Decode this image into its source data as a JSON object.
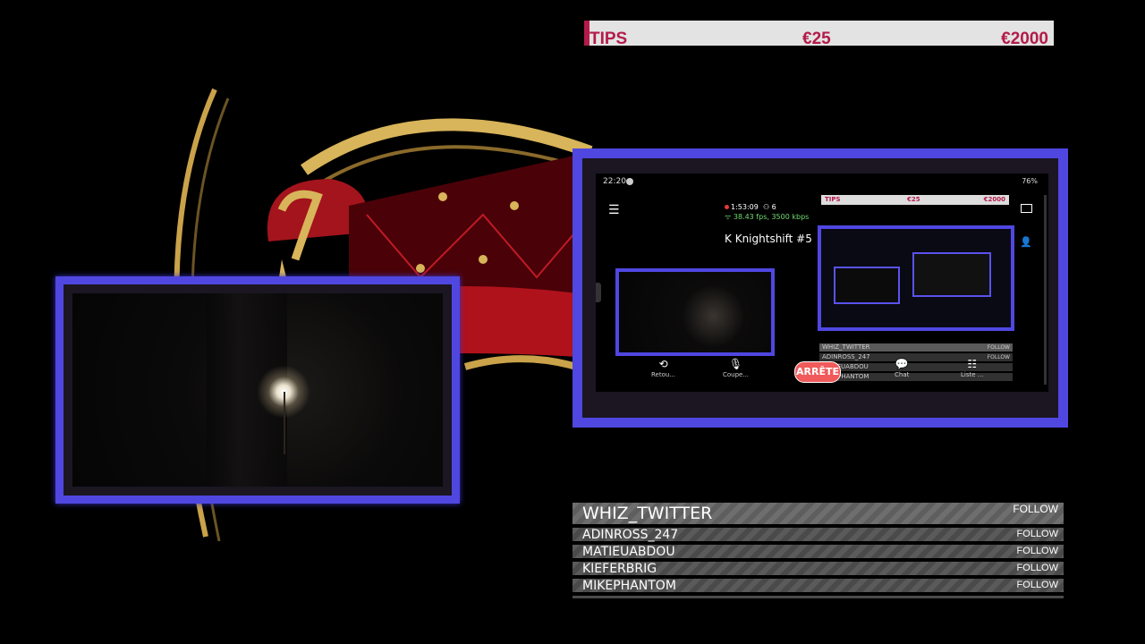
{
  "tips_bar": {
    "label": "TIPS",
    "amount": "€25",
    "goal": "€2000"
  },
  "phone": {
    "time": "22:20",
    "status": "76%",
    "rec_time": "1:53:09",
    "viewers": "6",
    "stream_stats": "38.43 fps, 3500 kbps",
    "stream_title": "Knightshift #5",
    "mini_tips": {
      "label": "TIPS",
      "amount": "€25",
      "goal": "€2000"
    },
    "buttons": {
      "back_label": "Retou...",
      "mute_label": "Coupe...",
      "stop_label": "ARRÊTE",
      "chat_label": "Chat",
      "list_label": "Liste ..."
    },
    "mini_feed": [
      {
        "name": "WHIZ_TWITTER",
        "badge": "FOLLOW"
      },
      {
        "name": "ADINROSS_247",
        "badge": "FOLLOW"
      },
      {
        "name": "MATIEUABDOU",
        "badge": ""
      },
      {
        "name": "MIKEPHANTOM",
        "badge": ""
      }
    ]
  },
  "follow_feed": [
    {
      "name": "WHIZ_TWITTER",
      "badge": "FOLLOW"
    },
    {
      "name": "ADINROSS_247",
      "badge": "FOLLOW"
    },
    {
      "name": "MATIEUABDOU",
      "badge": "FOLLOW"
    },
    {
      "name": "KIEFERBRIG",
      "badge": "FOLLOW"
    },
    {
      "name": "MIKEPHANTOM",
      "badge": "FOLLOW"
    }
  ],
  "colors": {
    "frame": "#4f47e0",
    "tips_accent": "#b31b4a",
    "stop_button": "#f05a5a",
    "sofa_red": "#a3141c",
    "sofa_gold": "#c9a24a"
  }
}
